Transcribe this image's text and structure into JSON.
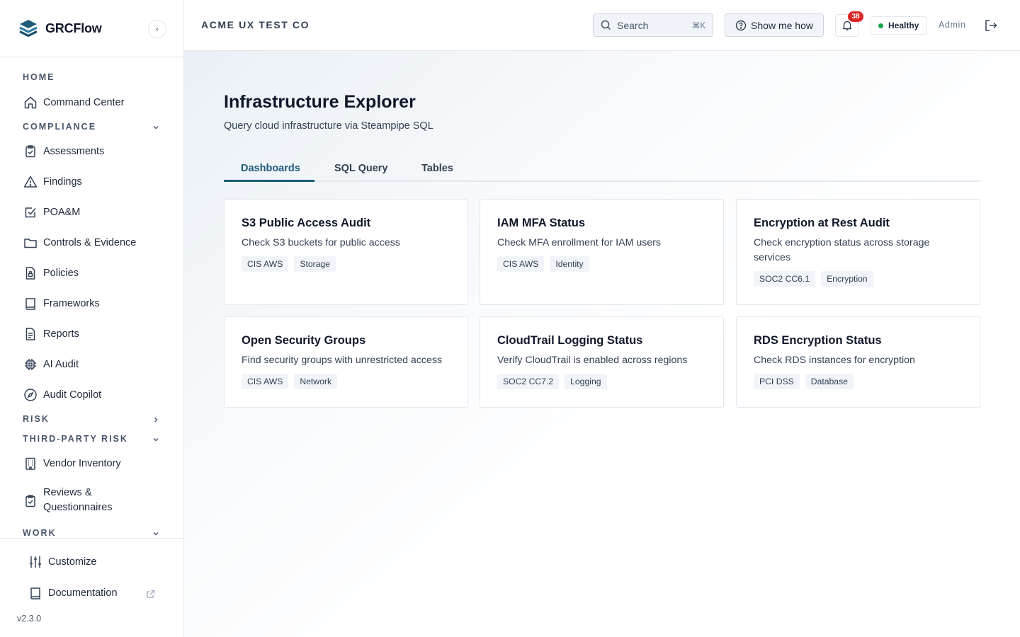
{
  "app": {
    "name": "GRCFlow",
    "version": "v2.3.0",
    "collapse_glyph": "‹"
  },
  "header": {
    "org_name": "ACME UX TEST CO",
    "search": {
      "placeholder": "Search",
      "shortcut": "⌘K"
    },
    "show_me_how": "Show me how",
    "notifications": {
      "count": "38"
    },
    "status": {
      "label": "Healthy",
      "color": "#16a34a"
    },
    "user": "Admin"
  },
  "sidebar": {
    "sections": {
      "home": "HOME",
      "compliance": "COMPLIANCE",
      "risk": "RISK",
      "third_party": "THIRD-PARTY RISK",
      "work": "WORK"
    },
    "items": {
      "command_center": "Command Center",
      "assessments": "Assessments",
      "findings": "Findings",
      "poam": "POA&M",
      "controls": "Controls & Evidence",
      "policies": "Policies",
      "frameworks": "Frameworks",
      "reports": "Reports",
      "ai_audit": "AI Audit",
      "audit_copilot": "Audit Copilot",
      "vendor_inventory": "Vendor Inventory",
      "reviews_line1": "Reviews &",
      "reviews_line2": "Questionnaires"
    },
    "footer": {
      "customize": "Customize",
      "documentation": "Documentation"
    }
  },
  "page": {
    "title": "Infrastructure Explorer",
    "subtitle": "Query cloud infrastructure via Steampipe SQL",
    "tabs": [
      "Dashboards",
      "SQL Query",
      "Tables"
    ],
    "active_tab": "Dashboards",
    "accent_color": "#1e5a7a"
  },
  "cards": [
    {
      "title": "S3 Public Access Audit",
      "description": "Check S3 buckets for public access",
      "tags": [
        "CIS AWS",
        "Storage"
      ]
    },
    {
      "title": "IAM MFA Status",
      "description": "Check MFA enrollment for IAM users",
      "tags": [
        "CIS AWS",
        "Identity"
      ]
    },
    {
      "title": "Encryption at Rest Audit",
      "description": "Check encryption status across storage services",
      "tags": [
        "SOC2 CC6.1",
        "Encryption"
      ]
    },
    {
      "title": "Open Security Groups",
      "description": "Find security groups with unrestricted access",
      "tags": [
        "CIS AWS",
        "Network"
      ]
    },
    {
      "title": "CloudTrail Logging Status",
      "description": "Verify CloudTrail is enabled across regions",
      "tags": [
        "SOC2 CC7.2",
        "Logging"
      ]
    },
    {
      "title": "RDS Encryption Status",
      "description": "Check RDS instances for encryption",
      "tags": [
        "PCI DSS",
        "Database"
      ]
    }
  ]
}
